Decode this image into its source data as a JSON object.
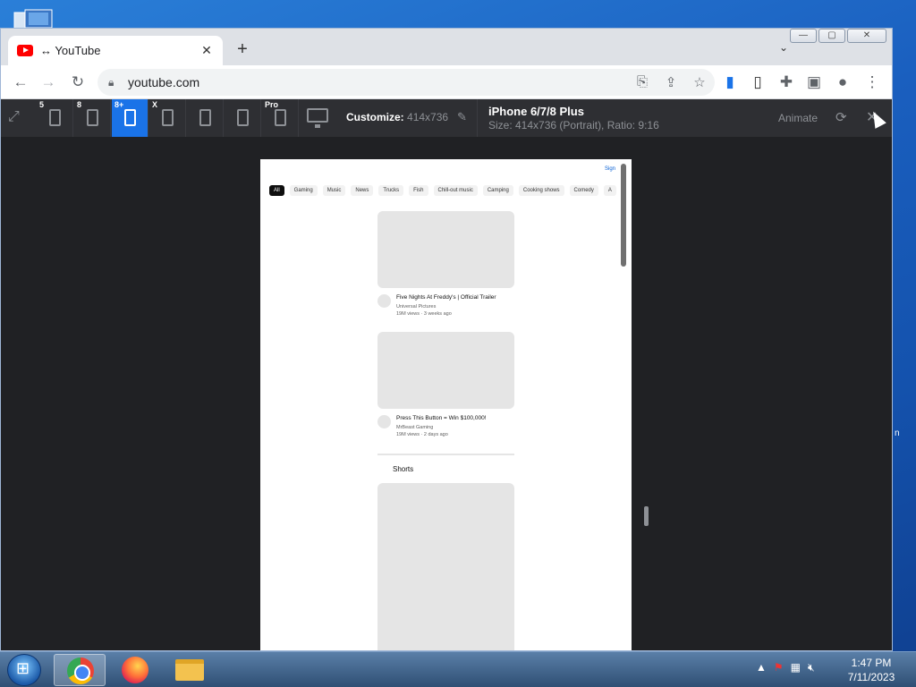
{
  "browser": {
    "tab_title": "↔ YouTube",
    "tab_close": "✕",
    "new_tab": "+",
    "tab_search": "⌄",
    "url": "youtube.com",
    "window_min": "—",
    "window_max": "▢",
    "window_close": "✕"
  },
  "responsive_viewer": {
    "devices": [
      {
        "badge": "5"
      },
      {
        "badge": "8"
      },
      {
        "badge": "8+"
      },
      {
        "badge": "X"
      },
      {
        "badge": ""
      },
      {
        "badge": ""
      },
      {
        "badge": "Pro"
      }
    ],
    "active_device_index": 2,
    "customize_label": "Customize:",
    "customize_value": "414x736",
    "device_name": "iPhone 6/7/8 Plus",
    "device_size": "Size: 414x736 (Portrait), Ratio: 9:16",
    "animate_label": "Animate"
  },
  "youtube": {
    "sign_in": "Sign",
    "chips": [
      "All",
      "Gaming",
      "Music",
      "News",
      "Trucks",
      "Fish",
      "Chill-out music",
      "Camping",
      "Cooking shows",
      "Comedy",
      "A"
    ],
    "videos": [
      {
        "title": "Five Nights At Freddy's | Official Trailer",
        "channel": "Universal Pictures",
        "stats": "19M views · 3 weeks ago"
      },
      {
        "title": "Press This Button = Win $100,000!",
        "channel": "MrBeast Gaming",
        "stats": "19M views · 2 days ago"
      }
    ],
    "shorts_label": "Shorts"
  },
  "taskbar": {
    "time": "1:47 PM",
    "date": "7/11/2023",
    "tray_arrow": "▲"
  },
  "edge_mark": "n",
  "colors": {
    "accent": "#1a73e8",
    "toolbar_dark": "#2e2f33",
    "stage": "#202124",
    "youtube_red": "#ff0000"
  }
}
